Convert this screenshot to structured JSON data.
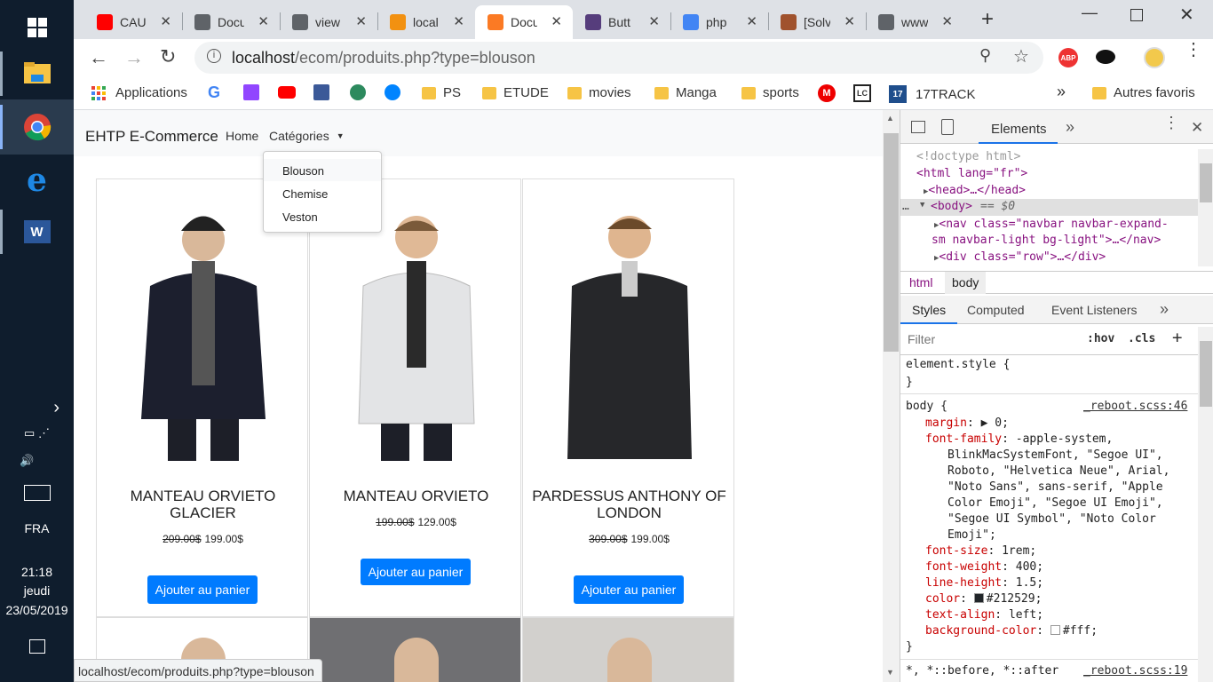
{
  "taskbar": {
    "lang": "FRA",
    "time": "21:18",
    "day": "jeudi",
    "date": "23/05/2019"
  },
  "tabs": [
    {
      "label": "CAU",
      "favicon": "youtube-icon",
      "color": "#ff0000"
    },
    {
      "label": "Docu",
      "favicon": "globe-icon",
      "color": "#5f6368"
    },
    {
      "label": "view",
      "favicon": "globe-icon",
      "color": "#5f6368"
    },
    {
      "label": "local",
      "favicon": "pma-icon",
      "color": "#f29111"
    },
    {
      "label": "Docu",
      "favicon": "xampp-icon",
      "color": "#fb7a24"
    },
    {
      "label": "Butt",
      "favicon": "bootstrap-icon",
      "color": "#563d7c"
    },
    {
      "label": "php",
      "favicon": "google-icon",
      "color": "#4285f4"
    },
    {
      "label": "[Solv",
      "favicon": "stack-icon",
      "color": "#a0522d"
    },
    {
      "label": "www",
      "favicon": "globe-icon",
      "color": "#5f6368"
    }
  ],
  "address": {
    "host": "localhost",
    "path": "/ecom/produits.php?type=blouson"
  },
  "bookmarks": {
    "apps": "Applications",
    "items": [
      "PS",
      "ETUDE",
      "movies",
      "Manga",
      "sports",
      "17TRACK"
    ],
    "more": "»",
    "others": "Autres favoris"
  },
  "navbar": {
    "brand": "EHTP E-Commerce",
    "home": "Home",
    "categories": "Catégories"
  },
  "dropdown": [
    "Blouson",
    "Chemise",
    "Veston"
  ],
  "products": [
    {
      "title": "MANTEAU ORVIETO GLACIER",
      "old_price": "209.00$",
      "price": "199.00$",
      "button": "Ajouter au panier"
    },
    {
      "title": "MANTEAU ORVIETO",
      "old_price": "199.00$",
      "price": "129.00$",
      "button": "Ajouter au panier"
    },
    {
      "title": "PARDESSUS ANTHONY OF LONDON",
      "old_price": "309.00$",
      "price": "199.00$",
      "button": "Ajouter au panier"
    }
  ],
  "status_url": "localhost/ecom/produits.php?type=blouson",
  "devtools": {
    "tab": "Elements",
    "dom": {
      "doctype": "<!doctype html>",
      "html_open": "<html lang=\"fr\">",
      "head": "<head>…</head>",
      "body": "<body>",
      "body_eq": "== $0",
      "nav_1": "<nav class=\"navbar navbar-expand-",
      "nav_2": "sm navbar-light bg-light\">…</nav>",
      "div": "<div class=\"row\">…</div>"
    },
    "crumbs": [
      "html",
      "body"
    ],
    "subtabs": [
      "Styles",
      "Computed",
      "Event Listeners"
    ],
    "filter_placeholder": "Filter",
    "hov": ":hov",
    "cls": ".cls",
    "element_style": "element.style {",
    "close_brace": "}",
    "rule_selector": "body {",
    "rule_source": "_reboot.scss:46",
    "props": [
      {
        "name": "margin",
        "value": "▶ 0;"
      },
      {
        "name": "font-family",
        "value": "-apple-system,"
      },
      {
        "name": "",
        "value": "BlinkMacSystemFont, \"Segoe UI\","
      },
      {
        "name": "",
        "value": "Roboto, \"Helvetica Neue\", Arial,"
      },
      {
        "name": "",
        "value": "\"Noto Sans\", sans-serif, \"Apple"
      },
      {
        "name": "",
        "value": "Color Emoji\", \"Segoe UI Emoji\","
      },
      {
        "name": "",
        "value": "\"Segoe UI Symbol\", \"Noto Color"
      },
      {
        "name": "",
        "value": "Emoji\";"
      },
      {
        "name": "font-size",
        "value": "1rem;"
      },
      {
        "name": "font-weight",
        "value": "400;"
      },
      {
        "name": "line-height",
        "value": "1.5;"
      },
      {
        "name": "color",
        "value": "#212529;"
      },
      {
        "name": "text-align",
        "value": "left;"
      },
      {
        "name": "background-color",
        "value": "#fff;"
      }
    ],
    "next_rule": "*, *::before, *::after",
    "next_source": "_reboot.scss:19"
  }
}
